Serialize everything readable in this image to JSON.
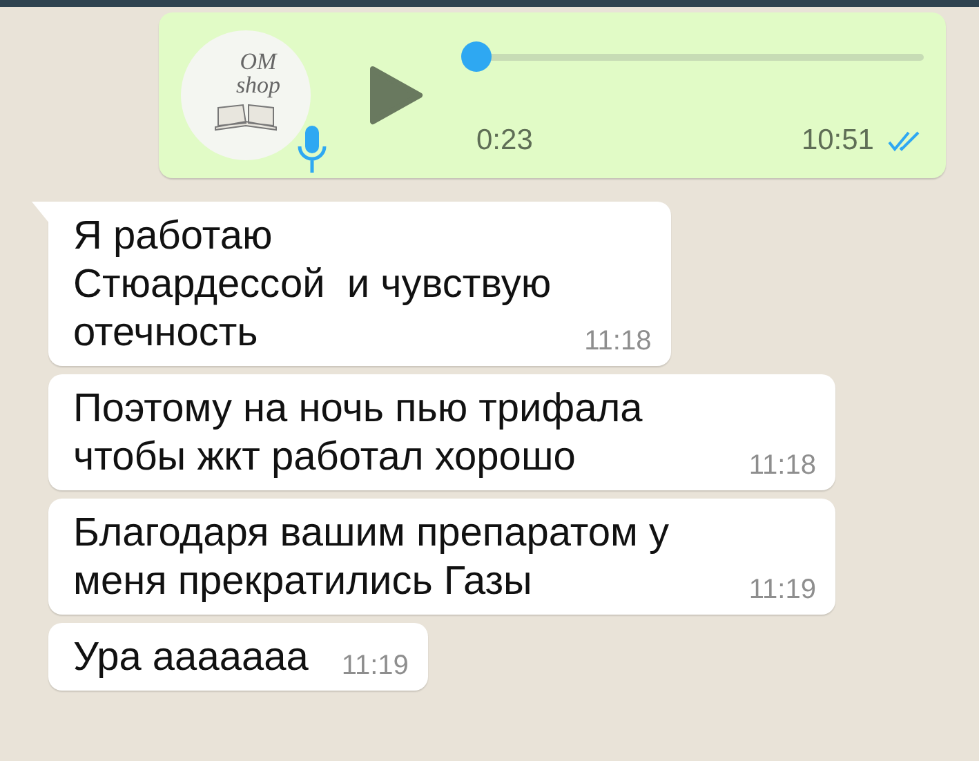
{
  "voice_message": {
    "logo_lines": [
      "OM",
      "shop"
    ],
    "level": 0,
    "duration": "0:23",
    "time": "10:51",
    "read": true
  },
  "messages": [
    {
      "text": "Я работаю\nСтюардессой  и чувствую\nотечность",
      "time": "11:18",
      "tail": true
    },
    {
      "text": "Поэтому на ночь пью трифала чтобы жкт работал хорошо",
      "time": "11:18",
      "tail": false
    },
    {
      "text": "Благодаря вашим препаратом у меня прекратились Газы",
      "time": "11:19",
      "tail": false
    },
    {
      "text": "Ура ааааааа",
      "time": "11:19",
      "tail": false
    }
  ]
}
